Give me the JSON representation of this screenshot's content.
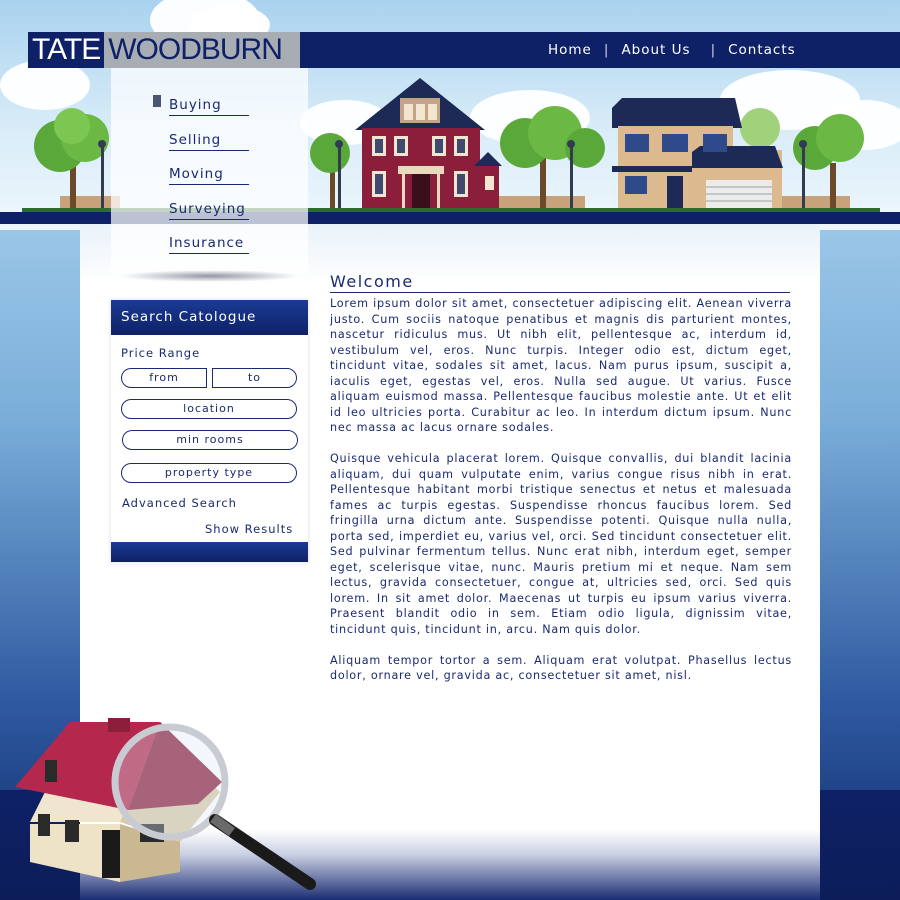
{
  "brand": {
    "part1": "TATE",
    "part2": "WOODBURN"
  },
  "topnav": {
    "items": [
      "Home",
      "About Us",
      "Contacts"
    ],
    "separator": "|"
  },
  "sidemenu": {
    "items": [
      "Buying",
      "Selling",
      "Moving",
      "Surveying",
      "Insurance"
    ]
  },
  "search": {
    "title": "Search Catologue",
    "price_label": "Price Range",
    "from_placeholder": "from",
    "to_placeholder": "to",
    "location_placeholder": "location",
    "rooms_placeholder": "min rooms",
    "type_placeholder": "property type",
    "advanced_label": "Advanced Search",
    "show_label": "Show Results"
  },
  "main": {
    "heading": "Welcome",
    "paragraphs": [
      "Lorem ipsum dolor sit amet, consectetuer adipiscing elit. Aenean viverra justo. Cum sociis natoque penatibus et magnis dis parturient montes, nascetur ridiculus mus. Ut nibh elit, pellentesque ac, interdum id, vestibulum vel, eros. Nunc turpis. Integer odio est, dictum eget, tincidunt vitae, sodales sit amet, lacus. Nam purus ipsum, suscipit a, iaculis eget, egestas vel, eros. Nulla sed augue. Ut varius. Fusce aliquam euismod massa. Pellentesque faucibus molestie ante. Ut et elit id leo ultricies porta. Curabitur ac leo. In interdum dictum ipsum. Nunc nec massa ac lacus ornare sodales.",
      "Quisque vehicula placerat lorem. Quisque convallis, dui blandit lacinia aliquam, dui quam vulputate enim, varius congue risus nibh in erat. Pellentesque habitant morbi tristique senectus et netus et malesuada fames ac turpis egestas. Suspendisse rhoncus faucibus lorem. Sed fringilla urna dictum ante. Suspendisse potenti. Quisque nulla nulla, porta sed, imperdiet eu, varius vel, orci. Sed tincidunt consectetuer elit. Sed pulvinar fermentum tellus. Nunc erat nibh, interdum eget, semper eget, scelerisque vitae, nunc. Mauris pretium mi et neque. Nam sem lectus, gravida consectetuer, congue at, ultricies sed, orci. Sed quis lorem. In sit amet dolor. Maecenas ut turpis eu ipsum varius viverra. Praesent blandit odio in sem. Etiam odio ligula, dignissim vitae, tincidunt quis, tincidunt in, arcu. Nam quis dolor.",
      "Aliquam tempor tortor a sem. Aliquam erat volutpat. Phasellus lectus dolor, ornare vel, gravida ac, consectetuer sit amet, nisl."
    ]
  },
  "colors": {
    "navy": "#0f2166",
    "text": "#1a2a72",
    "house_red": "#8b1e3a",
    "tree_green": "#5aa83a"
  },
  "icons": {
    "hero": "house-magnifier-icon",
    "menu_bullet": "menu-bullet-icon"
  }
}
